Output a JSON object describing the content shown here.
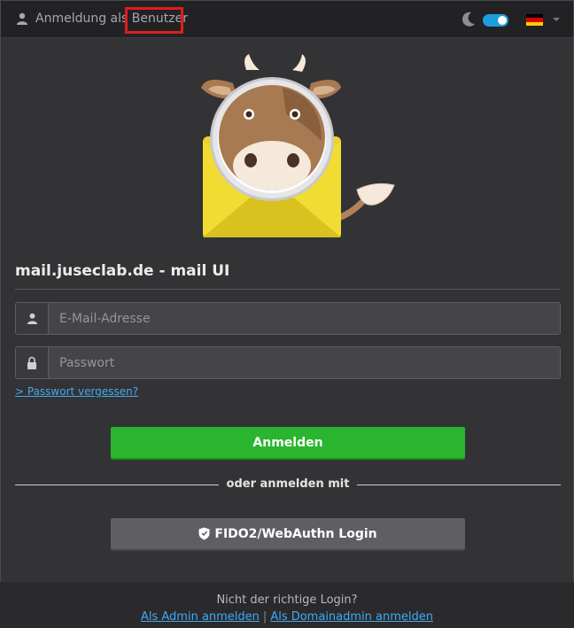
{
  "header": {
    "title": "Anmeldung als Benutzer",
    "user_icon": "user-icon",
    "theme_icon": "moon-icon",
    "dark_mode_on": true,
    "language_flag": "de",
    "flag_colors": [
      "#000000",
      "#dd0000",
      "#ffce00"
    ]
  },
  "login": {
    "heading": "mail.juseclab.de - mail UI",
    "email_placeholder": "E-Mail-Adresse",
    "email_value": "",
    "password_placeholder": "Passwort",
    "password_value": "",
    "forgot_label": "> Passwort vergessen?",
    "submit_label": "Anmelden",
    "divider_label": "oder anmelden mit",
    "fido_label": "FIDO2/WebAuthn Login"
  },
  "footer": {
    "question": "Nicht der richtige Login?",
    "admin_link": "Als Admin anmelden",
    "separator": "|",
    "domainadmin_link": "Als Domainadmin anmelden"
  },
  "colors": {
    "accent": "#1d9ddb",
    "submit": "#2ab52f",
    "link": "#41a9f0",
    "highlight": "#e11c1c"
  }
}
